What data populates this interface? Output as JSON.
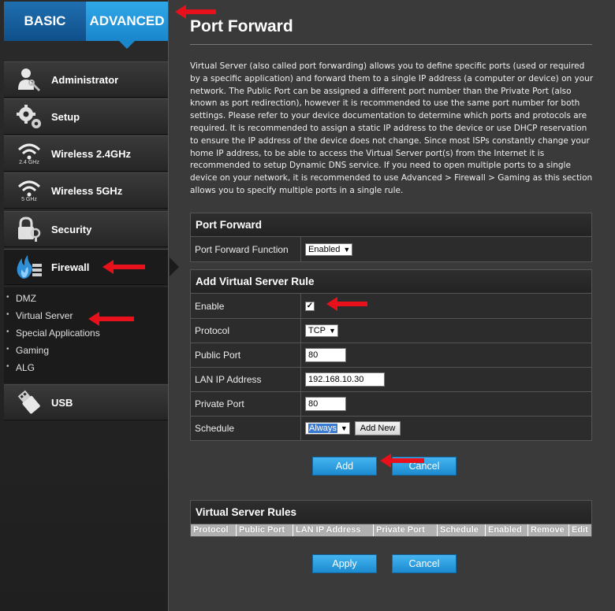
{
  "mode_tabs": {
    "basic": "BASIC",
    "advanced": "ADVANCED"
  },
  "nav": {
    "administrator": "Administrator",
    "setup": "Setup",
    "wireless24": "Wireless 2.4GHz",
    "wireless24_band": "2.4 GHz",
    "wireless5": "Wireless 5GHz",
    "wireless5_band": "5 GHz",
    "security": "Security",
    "firewall": "Firewall",
    "usb": "USB"
  },
  "subnav": [
    "DMZ",
    "Virtual Server",
    "Special Applications",
    "Gaming",
    "ALG"
  ],
  "page": {
    "title": "Port Forward",
    "description": "Virtual Server (also called port forwarding) allows you to define specific ports (used or required by a specific application) and forward them to a single IP address (a computer or device) on your network. The Public Port can be assigned a different port number than the Private Port (also known as port redirection), however it is recommended to use the same port number for both settings. Please refer to your device documentation to determine which ports and protocols are required. It is recommended to assign a static IP address to the device or use DHCP reservation to ensure the IP address of the device does not change. Since most ISPs constantly change your home IP address, to be able to access the Virtual Server port(s) from the Internet it is recommended to setup Dynamic DNS service. If you need to open multiple ports to a single device on your network, it is recommended to use Advanced > Firewall > Gaming as this section allows you to specify multiple ports in a single rule."
  },
  "port_forward": {
    "header": "Port Forward",
    "function_label": "Port Forward Function",
    "function_value": "Enabled"
  },
  "rule": {
    "header": "Add Virtual Server Rule",
    "enable_label": "Enable",
    "enable_mark": "✓",
    "protocol_label": "Protocol",
    "protocol_value": "TCP",
    "public_port_label": "Public Port",
    "public_port_value": "80",
    "lan_ip_label": "LAN IP Address",
    "lan_ip_value": "192.168.10.30",
    "private_port_label": "Private Port",
    "private_port_value": "80",
    "schedule_label": "Schedule",
    "schedule_value": "Always",
    "add_new_label": "Add New"
  },
  "buttons": {
    "add": "Add",
    "cancel": "Cancel",
    "apply": "Apply",
    "cancel2": "Cancel"
  },
  "rules_table": {
    "header": "Virtual Server Rules",
    "columns": [
      "Protocol",
      "Public Port",
      "LAN IP Address",
      "Private Port",
      "Schedule",
      "Enabled",
      "Remove",
      "Edit"
    ]
  },
  "colors": {
    "accent": "#2fa8e8",
    "arrow": "#e8101a"
  }
}
